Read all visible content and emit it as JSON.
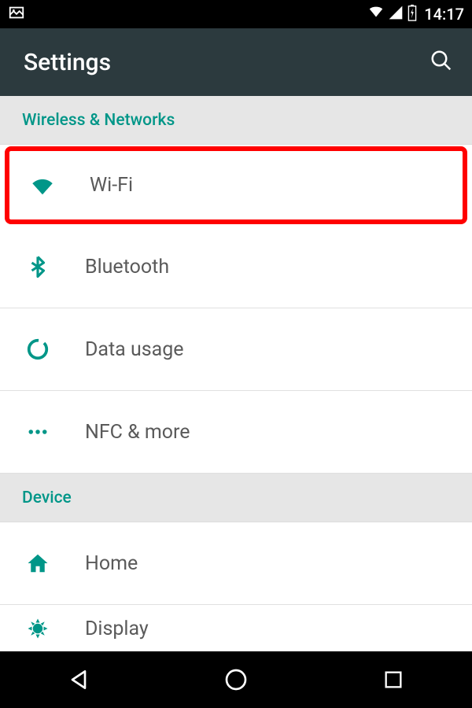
{
  "status": {
    "time": "14:17"
  },
  "header": {
    "title": "Settings"
  },
  "sections": {
    "wireless": {
      "title": "Wireless & Networks",
      "items": {
        "wifi": "Wi-Fi",
        "bluetooth": "Bluetooth",
        "data": "Data usage",
        "nfc": "NFC & more"
      }
    },
    "device": {
      "title": "Device",
      "items": {
        "home": "Home",
        "display": "Display"
      }
    }
  },
  "colors": {
    "accent": "#009688",
    "highlight": "#f00",
    "appbar": "#2c3a3e"
  }
}
